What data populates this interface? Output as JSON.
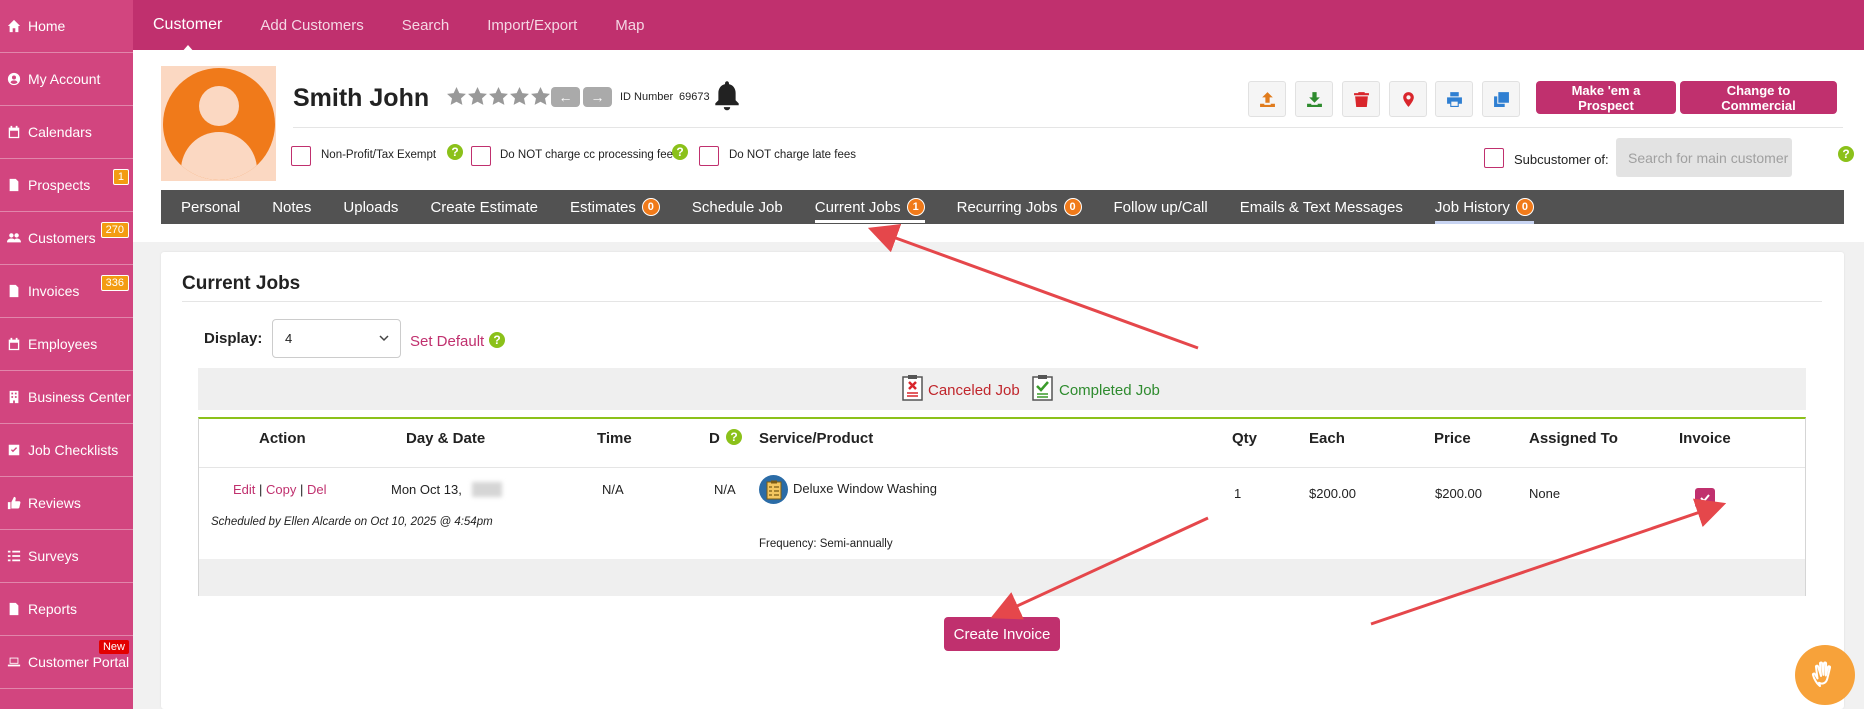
{
  "sidebar": {
    "items": [
      {
        "label": "Home",
        "icon": "home-icon",
        "badge": ""
      },
      {
        "label": "My Account",
        "icon": "user-circle-icon",
        "badge": ""
      },
      {
        "label": "Calendars",
        "icon": "calendar-icon",
        "badge": ""
      },
      {
        "label": "Prospects",
        "icon": "document-icon",
        "badge": "1"
      },
      {
        "label": "Customers",
        "icon": "users-icon",
        "badge": "270"
      },
      {
        "label": "Invoices",
        "icon": "document-icon",
        "badge": "336"
      },
      {
        "label": "Employees",
        "icon": "calendar-icon",
        "badge": ""
      },
      {
        "label": "Business Center",
        "icon": "building-icon",
        "badge": ""
      },
      {
        "label": "Job Checklists",
        "icon": "checkbox-icon",
        "badge": ""
      },
      {
        "label": "Reviews",
        "icon": "thumbs-up-icon",
        "badge": ""
      },
      {
        "label": "Surveys",
        "icon": "list-icon",
        "badge": ""
      },
      {
        "label": "Reports",
        "icon": "document-icon",
        "badge": ""
      },
      {
        "label": "Customer Portal",
        "icon": "laptop-icon",
        "badge": "New"
      }
    ]
  },
  "topnav": {
    "items": [
      "Customer",
      "Add Customers",
      "Search",
      "Import/Export",
      "Map"
    ],
    "active": "Customer"
  },
  "customer": {
    "name": "Smith John",
    "rating": 0,
    "id_label": "ID Number",
    "id_value": "69673"
  },
  "actions": {
    "prospect_label": "Make 'em a Prospect",
    "commercial_label": "Change to Commercial"
  },
  "flags": {
    "nonprofit": "Non-Profit/Tax Exempt",
    "no_cc_fee": "Do NOT charge cc processing fee",
    "no_late_fees": "Do NOT charge late fees",
    "subcustomer": "Subcustomer of:",
    "search_placeholder": "Search for main customer"
  },
  "tabs": [
    {
      "label": "Personal",
      "count": ""
    },
    {
      "label": "Notes",
      "count": ""
    },
    {
      "label": "Uploads",
      "count": ""
    },
    {
      "label": "Create Estimate",
      "count": ""
    },
    {
      "label": "Estimates",
      "count": "0"
    },
    {
      "label": "Schedule Job",
      "count": ""
    },
    {
      "label": "Current Jobs",
      "count": "1"
    },
    {
      "label": "Recurring Jobs",
      "count": "0"
    },
    {
      "label": "Follow up/Call",
      "count": ""
    },
    {
      "label": "Emails & Text Messages",
      "count": ""
    },
    {
      "label": "Job History",
      "count": "0"
    }
  ],
  "current_jobs": {
    "title": "Current Jobs",
    "display_label": "Display:",
    "display_value": "4",
    "set_default": "Set Default",
    "legend_canceled": "Canceled Job",
    "legend_completed": "Completed Job",
    "columns": {
      "action": "Action",
      "date": "Day & Date",
      "time": "Time",
      "d": "D",
      "service": "Service/Product",
      "qty": "Qty",
      "each": "Each",
      "price": "Price",
      "assigned": "Assigned To",
      "invoice": "Invoice"
    },
    "rows": [
      {
        "edit": "Edit",
        "copy": "Copy",
        "del": "Del",
        "date": "Mon Oct 13,",
        "time": "N/A",
        "d": "N/A",
        "service": "Deluxe Window Washing",
        "frequency": "Frequency: Semi-annually",
        "qty": "1",
        "each": "$200.00",
        "price": "$200.00",
        "assigned": "None",
        "invoice_checked": true,
        "scheduled_by": "Scheduled by Ellen Alcarde on Oct 10, 2025 @ 4:54pm"
      }
    ],
    "create_invoice": "Create Invoice"
  },
  "colors": {
    "brand": "#c0306e",
    "sidebar": "#d2457f",
    "badge": "#f07a1a",
    "help": "#8bc11a",
    "annotation_arrow": "#e5474b"
  }
}
